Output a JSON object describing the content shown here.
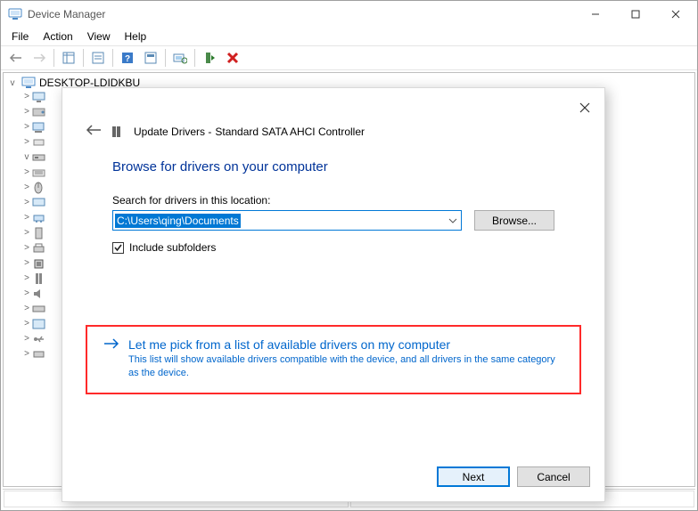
{
  "window": {
    "title": "Device Manager",
    "menu": {
      "file": "File",
      "action": "Action",
      "view": "View",
      "help": "Help"
    },
    "tree_root": "DESKTOP-LDIDKBU",
    "tree_child_expanders": [
      ">",
      ">",
      ">",
      ">",
      "v",
      ">",
      ">",
      ">",
      ">",
      ">",
      ">",
      ">",
      ">",
      ">",
      ">",
      ">",
      ">",
      ">"
    ]
  },
  "dialog": {
    "header_prefix": "Update Drivers -",
    "header_device": "Standard SATA AHCI Controller",
    "heading": "Browse for drivers on your computer",
    "search_label": "Search for drivers in this location:",
    "path_value": "C:\\Users\\qing\\Documents",
    "browse_label": "Browse...",
    "include_subfolders": "Include subfolders",
    "include_subfolders_checked": true,
    "option_title": "Let me pick from a list of available drivers on my computer",
    "option_desc": "This list will show available drivers compatible with the device, and all drivers in the same category as the device.",
    "next_label": "Next",
    "cancel_label": "Cancel"
  }
}
